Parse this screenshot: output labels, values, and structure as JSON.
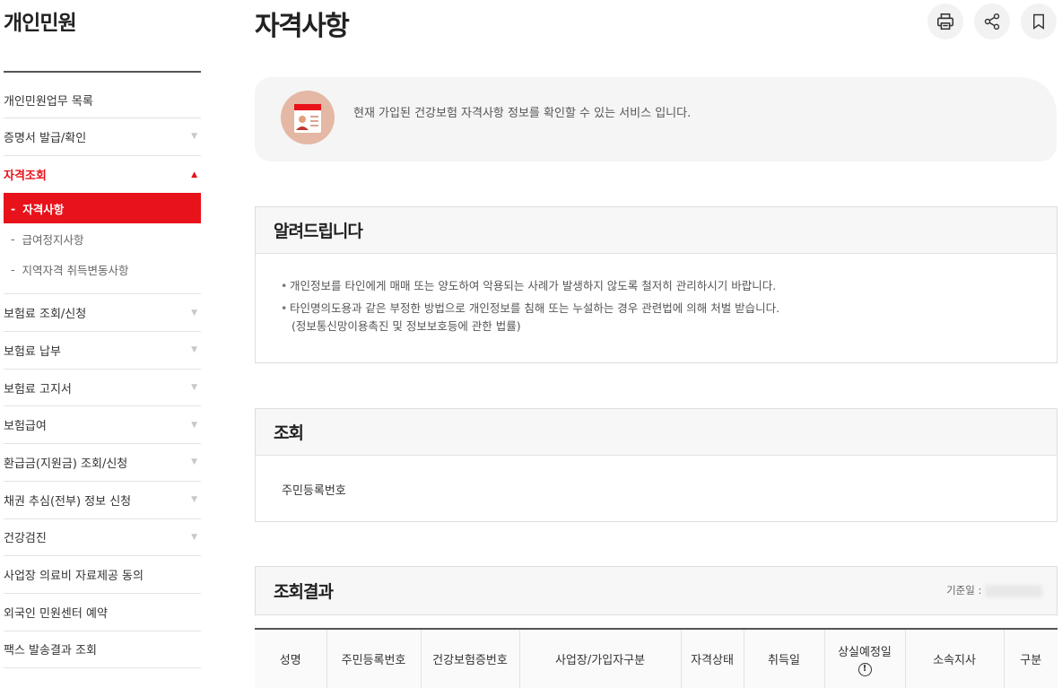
{
  "sidebar": {
    "title": "개인민원",
    "items": [
      {
        "label": "개인민원업무 목록"
      },
      {
        "label": "증명서 발급/확인"
      },
      {
        "label": "자격조회"
      },
      {
        "label": "보험료 조회/신청"
      },
      {
        "label": "보험료 납부"
      },
      {
        "label": "보험료 고지서"
      },
      {
        "label": "보험급여"
      },
      {
        "label": "환급금(지원금) 조회/신청"
      },
      {
        "label": "채권 추심(전부) 정보 신청"
      },
      {
        "label": "건강검진"
      },
      {
        "label": "사업장 의료비 자료제공 동의"
      },
      {
        "label": "외국인 민원센터 예약"
      },
      {
        "label": "팩스 발송결과 조회"
      }
    ],
    "submenu": [
      {
        "label": "자격사항"
      },
      {
        "label": "급여정지사항"
      },
      {
        "label": "지역자격 취득변동사항"
      }
    ]
  },
  "page": {
    "title": "자격사항"
  },
  "toolbar": {
    "icons": [
      "print-icon",
      "share-icon",
      "bookmark-icon"
    ]
  },
  "intro": {
    "text": "현재 가입된 건강보험 자격사항 정보를 확인할 수 있는 서비스 입니다."
  },
  "notice": {
    "title": "알려드립니다",
    "line1": "개인정보를 타인에게 매매 또는 양도하여 악용되는 사례가 발생하지 않도록 철저히 관리하시기 바랍니다.",
    "line2": "타인명의도용과 같은 부정한 방법으로 개인정보를 침해 또는 누설하는 경우 관련법에 의해 처벌 받습니다.",
    "line2_sub": "(정보통신망이용촉진 및 정보보호등에 관한 법률)"
  },
  "query": {
    "title": "조회",
    "label": "주민등록번호"
  },
  "result": {
    "title": "조회결과",
    "base_date_label": "기준일 : "
  },
  "table": {
    "headers": [
      "성명",
      "주민등록번호",
      "건강보험증번호",
      "사업장/가입자구분",
      "자격상태",
      "취득일",
      "상실예정일",
      "소속지사",
      "구분"
    ]
  },
  "colors": {
    "accent": "#e8121a"
  }
}
